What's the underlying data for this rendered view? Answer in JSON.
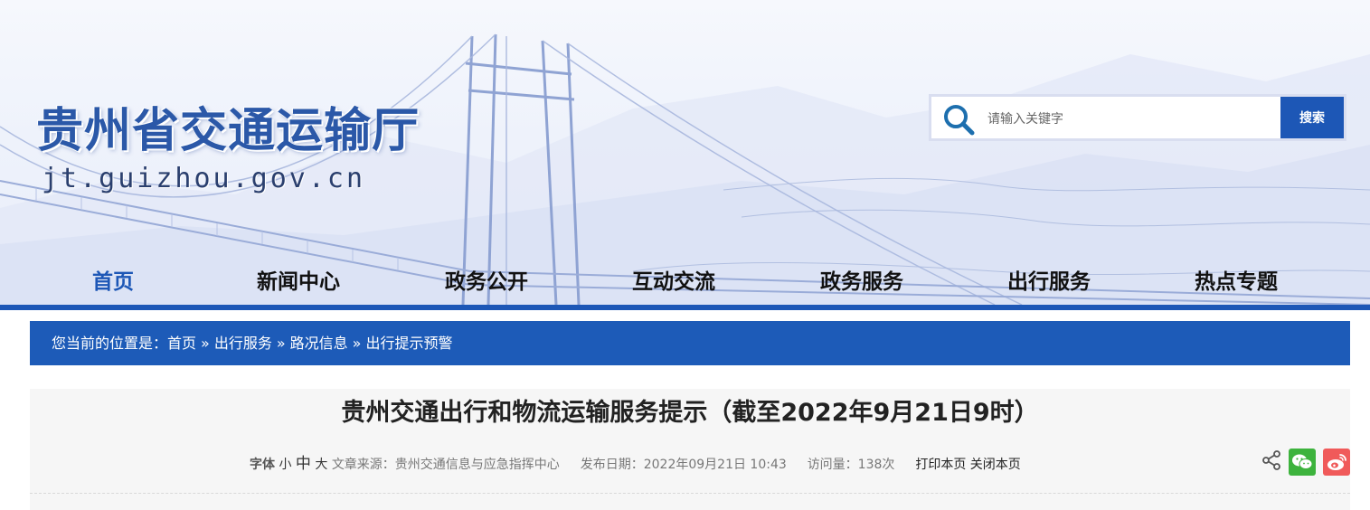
{
  "site": {
    "name_cn": "贵州省交通运输厅",
    "domain": "jt.guizhou.gov.cn"
  },
  "search": {
    "placeholder": "请输入关键字",
    "button_label": "搜索"
  },
  "nav": {
    "items": [
      {
        "label": "首页",
        "active": true
      },
      {
        "label": "新闻中心"
      },
      {
        "label": "政务公开"
      },
      {
        "label": "互动交流"
      },
      {
        "label": "政务服务"
      },
      {
        "label": "出行服务"
      },
      {
        "label": "热点专题"
      }
    ]
  },
  "breadcrumb": {
    "prefix": "您当前的位置是：",
    "items": [
      "首页",
      "出行服务",
      "路况信息",
      "出行提示预警"
    ],
    "separator": "»"
  },
  "article": {
    "title": "贵州交通出行和物流运输服务提示（截至2022年9月21日9时）",
    "font_label": "字体",
    "font_small": "小",
    "font_medium": "中",
    "font_large": "大",
    "source": "文章来源：贵州交通信息与应急指挥中心",
    "date": "发布日期：2022年09月21日 10:43",
    "visits": "访问量：138次",
    "print_label": "打印本页",
    "close_label": "关闭本页"
  },
  "colors": {
    "primary_blue": "#1d57b6",
    "wechat_green": "#3db33d",
    "weibo_red": "#f05a5a"
  },
  "icons": [
    "search-icon",
    "share-icon",
    "wechat-icon",
    "weibo-icon"
  ]
}
